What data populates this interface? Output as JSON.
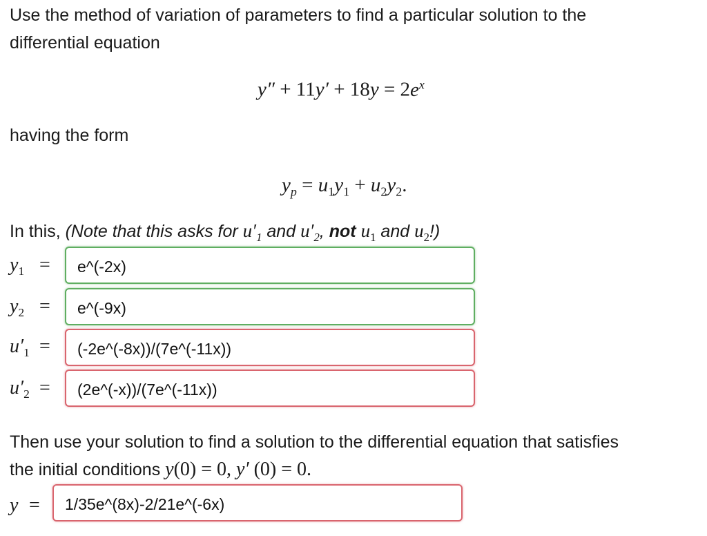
{
  "problem": {
    "intro_line1": "Use the method of variation of parameters to find a particular solution to the",
    "intro_line2": "differential equation",
    "having_form": "having the form",
    "note_prefix": "In this,",
    "note_italic": "(Note that this asks for",
    "note_and": "and",
    "note_not": "not",
    "note_and2": "and",
    "note_end": "!)",
    "then_line1": "Then use your solution to find a solution to the differential equation that satisfies",
    "then_line2": "the initial conditions"
  },
  "answers": {
    "y1": "e^(-2x)",
    "y2": "e^(-9x)",
    "u1_prime": "(-2e^(-8x))/(7e^(-11x))",
    "u2_prime": "(2e^(-x))/(7e^(-11x))",
    "y": "1/35e^(8x)-2/21e^(-6x)"
  },
  "status_colors": {
    "correct": "#5fae61",
    "incorrect": "#d9656e"
  }
}
